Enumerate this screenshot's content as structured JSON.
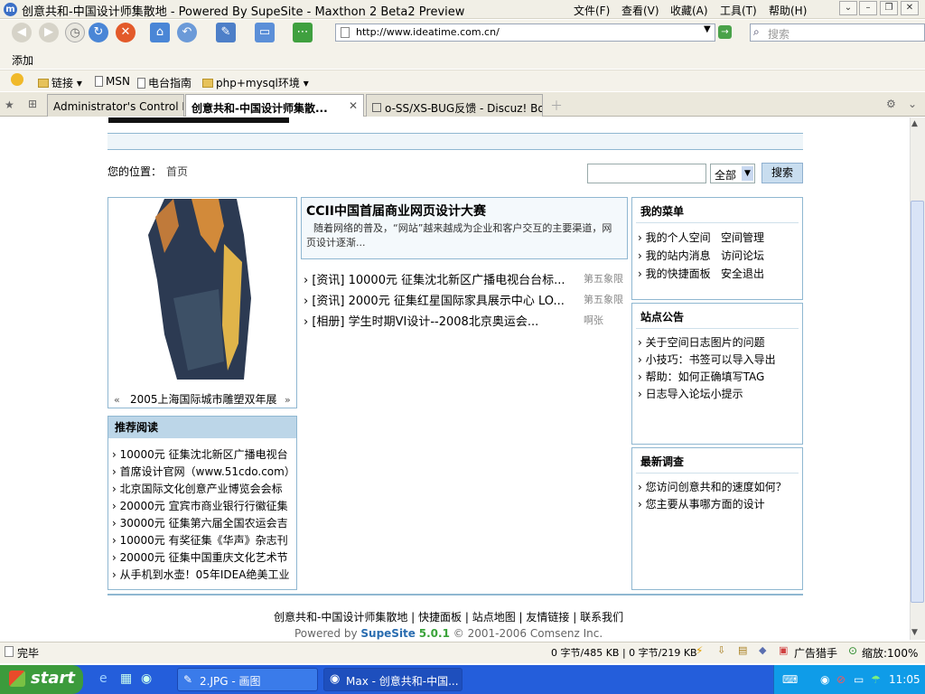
{
  "window": {
    "title": "创意共和-中国设计师集散地 - Powered By SupeSite - Maxthon 2 Beta2 Preview",
    "menus": [
      "文件(F)",
      "查看(V)",
      "收藏(A)",
      "工具(T)",
      "帮助(H)"
    ]
  },
  "toolbar": {
    "address": "http://www.ideatime.com.cn/",
    "search_placeholder": "搜索",
    "add_label": "添加"
  },
  "favorites": [
    "链接",
    "MSN",
    "电台指南",
    "php+mysql环境"
  ],
  "tabs": [
    {
      "label": "Administrator's Control Panel"
    },
    {
      "label": "创意共和-中国设计师集散..."
    },
    {
      "label": "o-SS/XS-BUG反馈 - Discuz! Boar..."
    }
  ],
  "page": {
    "location_label": "您的位置：",
    "location_home": "首页",
    "search_scope": "全部",
    "search_button": "搜索",
    "feature": {
      "caption": "2005上海国际城市雕塑双年展",
      "prev": "«",
      "next": "»"
    },
    "headline": {
      "title": "CCII中国首届商业网页设计大赛",
      "summary": "随着网络的普及，“网站”越来越成为企业和客户交互的主要渠道，网页设计逐渐..."
    },
    "news": [
      {
        "text": "[资讯] 10000元 征集沈北新区广播电视台台标...",
        "author": "第五象限"
      },
      {
        "text": "[资讯] 2000元 征集红星国际家具展示中心 LO...",
        "author": "第五象限"
      },
      {
        "text": "[相册] 学生时期VI设计--2008北京奥运会...",
        "author": "啊张"
      }
    ],
    "recommend": {
      "title": "推荐阅读",
      "items": [
        "10000元 征集沈北新区广播电视台",
        "首席设计官网（www.51cdo.com）",
        "北京国际文化创意产业博览会会标",
        "20000元 宜宾市商业银行行徽征集",
        "30000元 征集第六届全国农运会吉",
        "10000元 有奖征集《华声》杂志刊",
        "20000元 征集中国重庆文化艺术节",
        "从手机到水壶！05年IDEA绝美工业"
      ]
    },
    "my_menu": {
      "title": "我的菜单",
      "items": [
        [
          "我的个人空间",
          "空间管理"
        ],
        [
          "我的站内消息",
          "访问论坛"
        ],
        [
          "我的快捷面板",
          "安全退出"
        ]
      ]
    },
    "notice": {
      "title": "站点公告",
      "items": [
        "关于空间日志图片的问题",
        "小技巧：书签可以导入导出",
        "帮助：如何正确填写TAG",
        "日志导入论坛小提示"
      ]
    },
    "survey": {
      "title": "最新调查",
      "items": [
        "您访问创意共和的速度如何？",
        "您主要从事哪方面的设计"
      ]
    },
    "footer": {
      "links": [
        "创意共和-中国设计师集散地",
        "快捷面板",
        "站点地图",
        "友情链接",
        "联系我们"
      ],
      "powered_prefix": "Powered by",
      "brand": "SupeSite",
      "version": "5.0.1",
      "copyright": "© 2001-2006",
      "company": "Comsenz Inc."
    }
  },
  "status": {
    "text": "完毕",
    "traffic": "0 字节/485 KB | 0 字节/219 KB",
    "adblock": "广告猎手",
    "zoom": "缩放:100%"
  },
  "taskbar": {
    "start": "start",
    "tasks": [
      "2.JPG - 画图",
      "Max - 创意共和-中国..."
    ],
    "time": "11:05"
  }
}
